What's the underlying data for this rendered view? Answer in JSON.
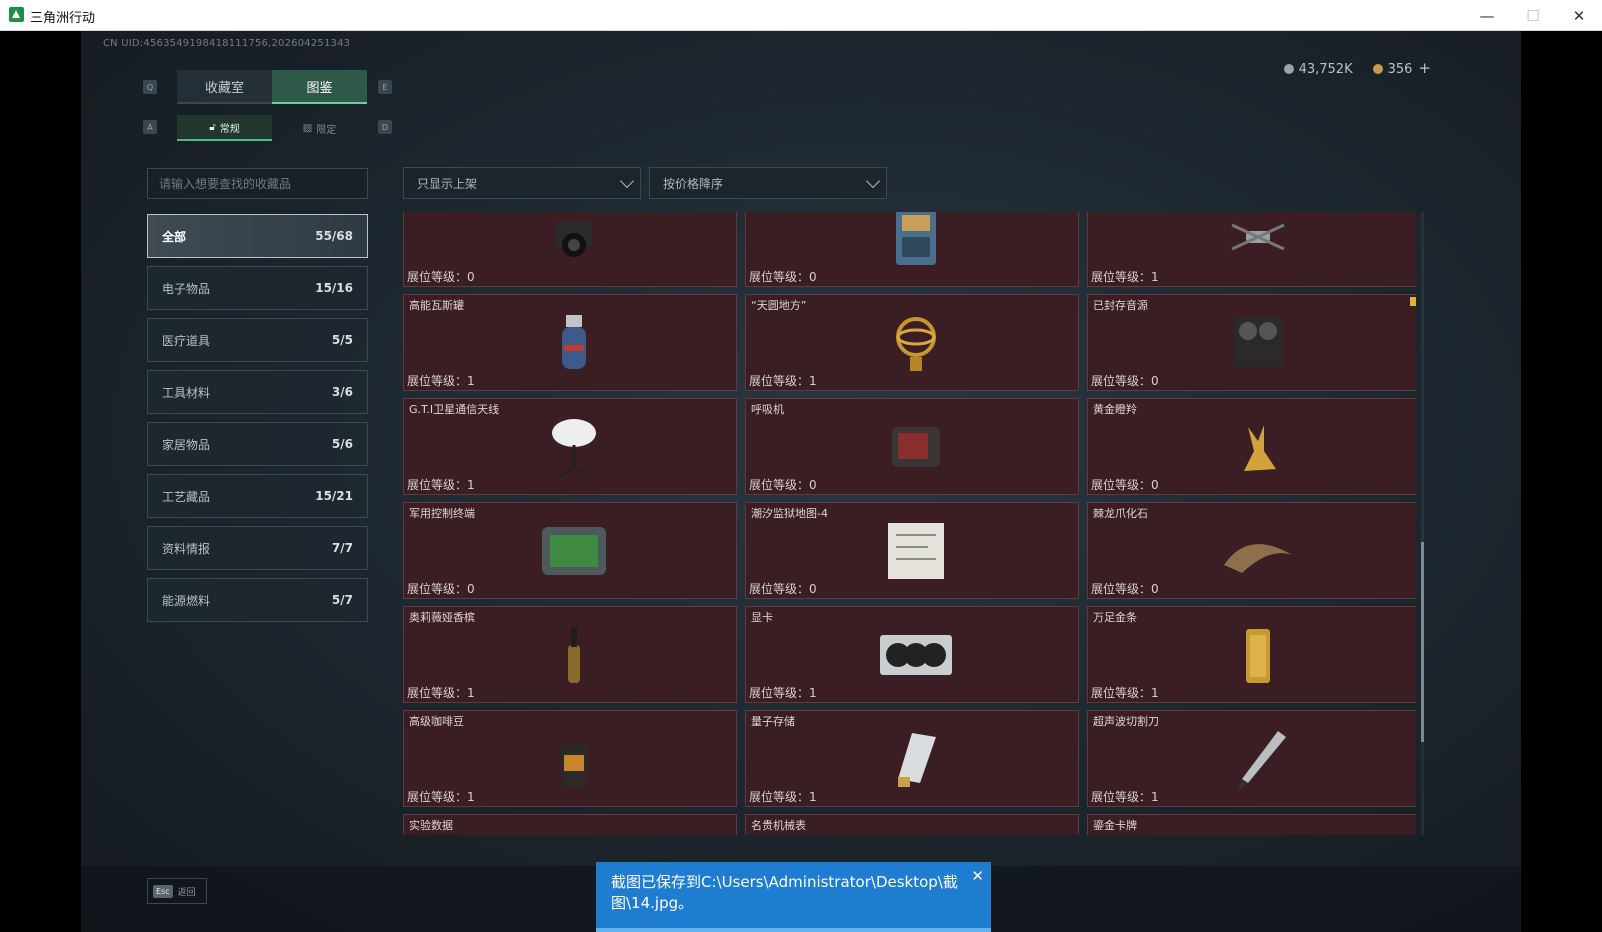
{
  "window": {
    "title": "三角洲行动",
    "min_icon": "minimize-icon",
    "max_icon": "maximize-icon",
    "close_icon": "close-icon"
  },
  "uid": "CN UID:4563549198418111756,202604251343",
  "currency": {
    "silver": "43,752K",
    "gold": "356",
    "add": "+"
  },
  "keyhints": {
    "q": "Q",
    "e": "E",
    "a": "A",
    "d": "D"
  },
  "tabs": {
    "collection_room": "收藏室",
    "catalog": "图鉴",
    "regular": "常规",
    "limited": "限定"
  },
  "search": {
    "placeholder": "请输入想要查找的收藏品"
  },
  "categories": [
    {
      "label": "全部",
      "count": "55/68"
    },
    {
      "label": "电子物品",
      "count": "15/16"
    },
    {
      "label": "医疗道具",
      "count": "5/5"
    },
    {
      "label": "工具材料",
      "count": "3/6"
    },
    {
      "label": "家居物品",
      "count": "5/6"
    },
    {
      "label": "工艺藏品",
      "count": "15/21"
    },
    {
      "label": "资料情报",
      "count": "7/7"
    },
    {
      "label": "能源燃料",
      "count": "5/7"
    }
  ],
  "filters": {
    "show": "只显示上架",
    "sort": "按价格降序"
  },
  "items": [
    {
      "name": "",
      "level": "展位等级：0",
      "icon": "camera-icon"
    },
    {
      "name": "",
      "level": "展位等级：0",
      "icon": "engine-icon"
    },
    {
      "name": "",
      "level": "展位等级：1",
      "icon": "drone-icon"
    },
    {
      "name": "高能瓦斯罐",
      "level": "展位等级：1",
      "icon": "gas-canister-icon"
    },
    {
      "name": "“天圆地方”",
      "level": "展位等级：1",
      "icon": "armillary-sphere-icon"
    },
    {
      "name": "已封存音源",
      "level": "展位等级：0",
      "icon": "reel-recorder-icon"
    },
    {
      "name": "G.T.I卫星通信天线",
      "level": "展位等级：1",
      "icon": "satellite-dish-icon"
    },
    {
      "name": "呼吸机",
      "level": "展位等级：0",
      "icon": "ventilator-icon"
    },
    {
      "name": "黄金瞪羚",
      "level": "展位等级：0",
      "icon": "gold-gazelle-icon"
    },
    {
      "name": "军用控制终端",
      "level": "展位等级：0",
      "icon": "control-terminal-icon"
    },
    {
      "name": "潮汐监狱地图-4",
      "level": "展位等级：0",
      "icon": "map-icon"
    },
    {
      "name": "棘龙爪化石",
      "level": "展位等级：0",
      "icon": "claw-fossil-icon"
    },
    {
      "name": "奥莉薇娅香槟",
      "level": "展位等级：1",
      "icon": "champagne-icon"
    },
    {
      "name": "显卡",
      "level": "展位等级：1",
      "icon": "graphics-card-icon"
    },
    {
      "name": "万足金条",
      "level": "展位等级：1",
      "icon": "gold-bar-icon"
    },
    {
      "name": "高级咖啡豆",
      "level": "展位等级：1",
      "icon": "coffee-bag-icon"
    },
    {
      "name": "量子存储",
      "level": "展位等级：1",
      "icon": "quantum-storage-icon"
    },
    {
      "name": "超声波切割刀",
      "level": "展位等级：1",
      "icon": "ultrasonic-knife-icon"
    },
    {
      "name": "实验数据",
      "level": "",
      "icon": "data-icon"
    },
    {
      "name": "名贵机械表",
      "level": "",
      "icon": "watch-icon"
    },
    {
      "name": "鎏金卡牌",
      "level": "",
      "icon": "card-icon"
    }
  ],
  "bottom": {
    "esc_key": "Esc",
    "esc_label": "返回"
  },
  "toast": {
    "message": "截图已保存到C:\\Users\\Administrator\\Desktop\\截图\\14.jpg。",
    "close": "✕"
  }
}
